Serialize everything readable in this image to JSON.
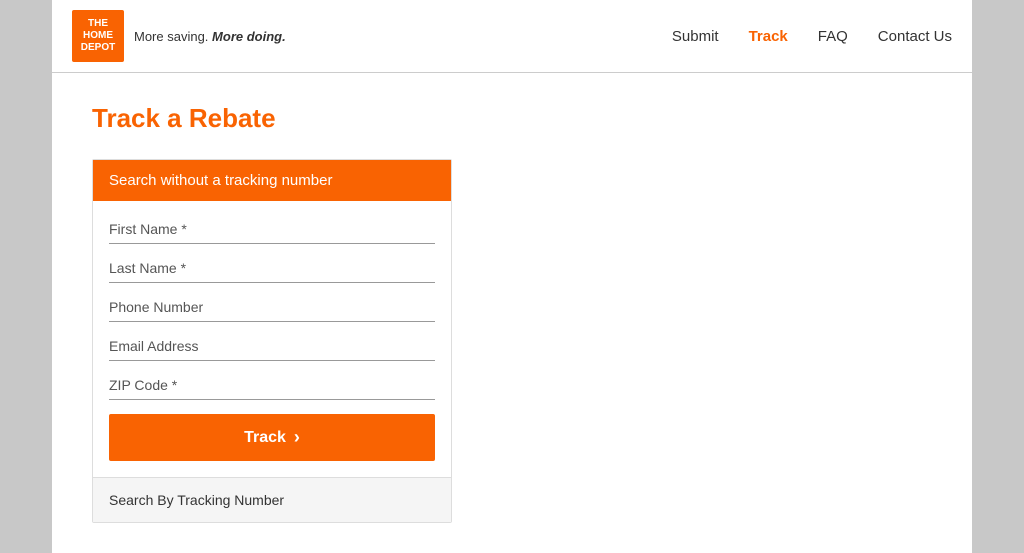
{
  "header": {
    "tagline": "More saving. More doing.",
    "logo_lines": [
      "THE",
      "HOME",
      "DEPOT"
    ],
    "nav": [
      {
        "label": "Submit",
        "id": "submit",
        "active": false
      },
      {
        "label": "Track",
        "id": "track",
        "active": true
      },
      {
        "label": "FAQ",
        "id": "faq",
        "active": false
      },
      {
        "label": "Contact Us",
        "id": "contact",
        "active": false
      }
    ]
  },
  "main": {
    "page_title": "Track a Rebate",
    "form_card": {
      "header_label": "Search without a tracking number",
      "fields": [
        {
          "id": "first-name",
          "placeholder": "First Name *"
        },
        {
          "id": "last-name",
          "placeholder": "Last Name *"
        },
        {
          "id": "phone",
          "placeholder": "Phone Number"
        },
        {
          "id": "email",
          "placeholder": "Email Address"
        },
        {
          "id": "zip",
          "placeholder": "ZIP Code *"
        }
      ],
      "track_button_label": "Track",
      "track_button_arrow": "›",
      "alternate_search_label": "Search By Tracking Number"
    }
  },
  "colors": {
    "orange": "#f96302",
    "white": "#ffffff",
    "light_gray": "#f5f5f5",
    "border": "#dddddd",
    "text_dark": "#333333"
  }
}
